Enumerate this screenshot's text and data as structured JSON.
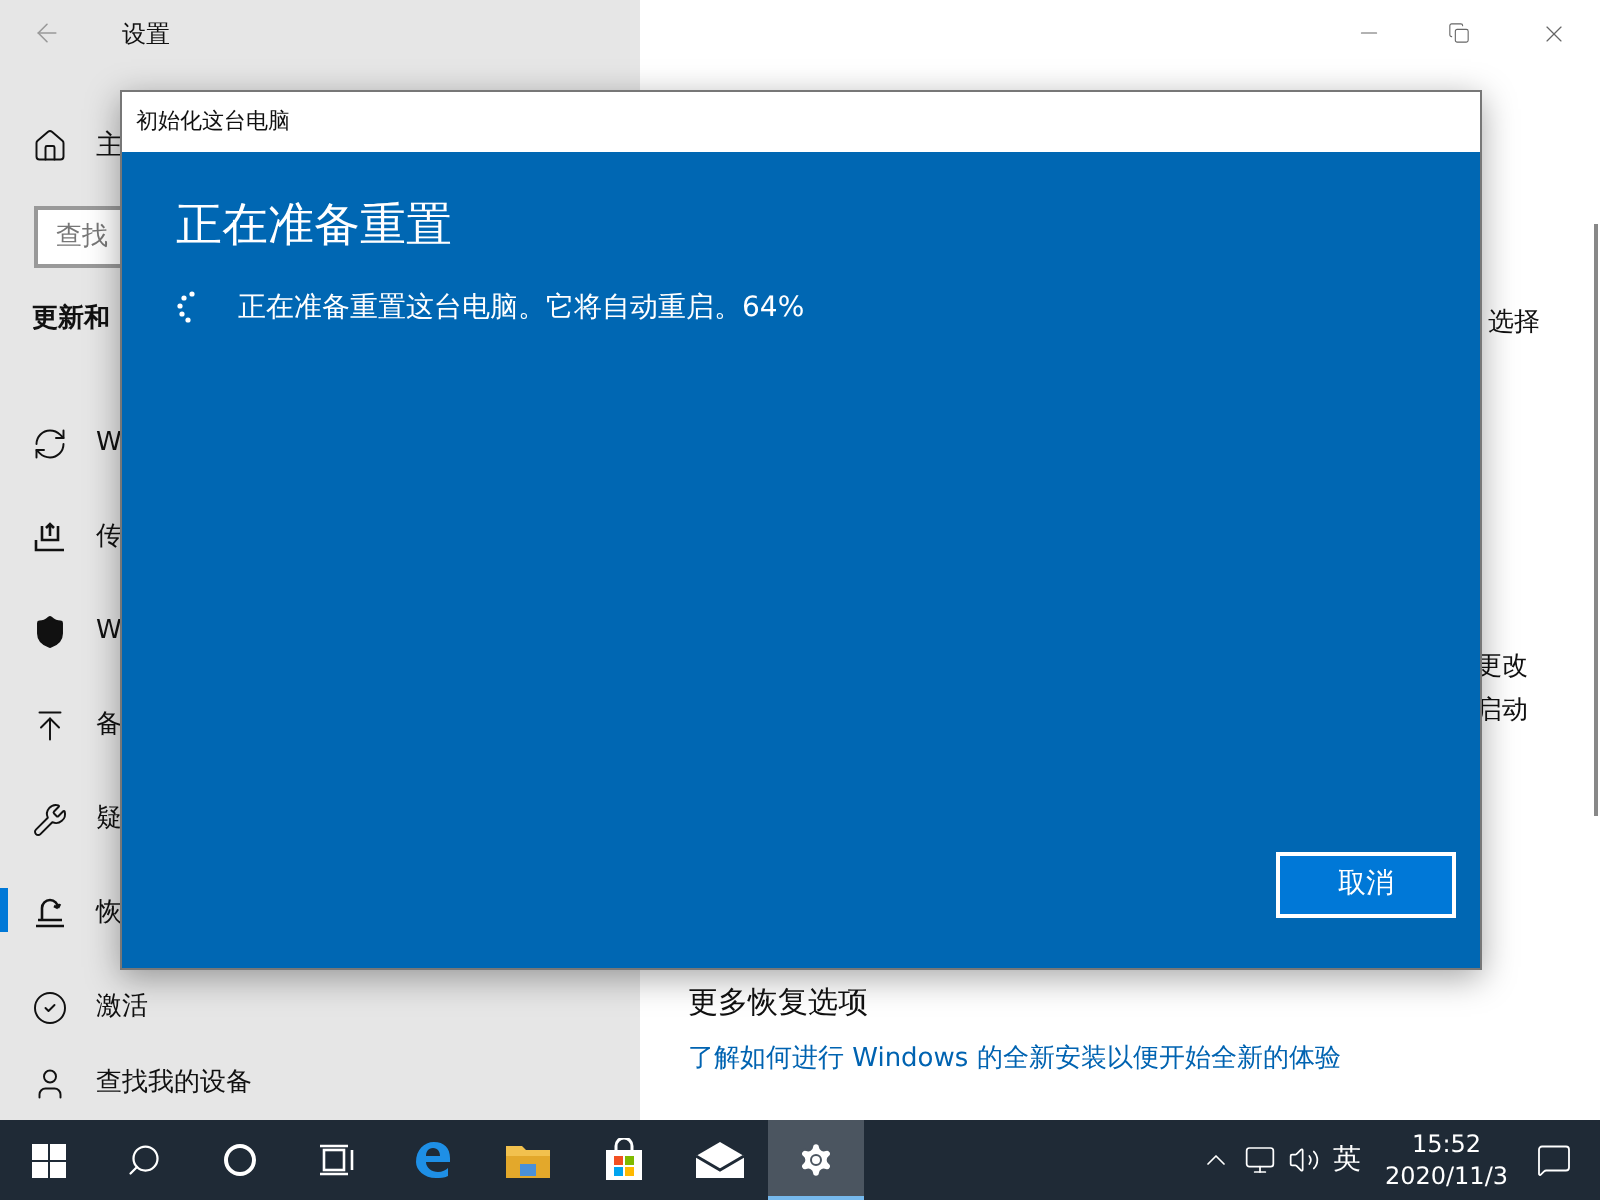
{
  "settings_window": {
    "title": "设置",
    "home_label": "主",
    "search": {
      "placeholder": "查找"
    },
    "section_header": "更新和",
    "nav_items": [
      {
        "label": "W",
        "selected": false
      },
      {
        "label": "传",
        "selected": false
      },
      {
        "label": "W",
        "selected": false
      },
      {
        "label": "备",
        "selected": false
      },
      {
        "label": "疑",
        "selected": false
      },
      {
        "label": "恢",
        "selected": true
      },
      {
        "label": "激活",
        "selected": false
      },
      {
        "label": "查找我的设备",
        "selected": false
      }
    ],
    "content": {
      "fragment_1": "选择",
      "fragment_2": "更改",
      "fragment_3": "启动",
      "heading": "更多恢复选项",
      "link": "了解如何进行 Windows 的全新安装以便开始全新的体验"
    }
  },
  "dialog": {
    "title": "初始化这台电脑",
    "heading": "正在准备重置",
    "message": "正在准备重置这台电脑。它将自动重启。64%",
    "cancel_button": "取消"
  },
  "taskbar": {
    "apps": [
      {
        "active": false
      },
      {
        "active": false
      },
      {
        "active": false
      },
      {
        "active": false
      },
      {
        "active": false
      },
      {
        "active": false
      },
      {
        "active": false
      },
      {
        "active": true
      }
    ],
    "input_language": "英",
    "time": "15:52",
    "date": "2020/11/3"
  }
}
